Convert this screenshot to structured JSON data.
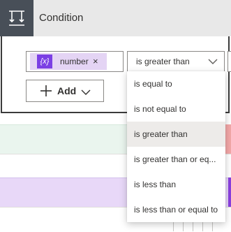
{
  "card": {
    "title": "Condition",
    "icon": "condition-icon"
  },
  "operand": {
    "token_icon": "{x}",
    "token_label": "number",
    "remove_glyph": "×"
  },
  "operator": {
    "selected": "is greater than",
    "chevron": "chevron-down-icon"
  },
  "add_button": {
    "label": "Add"
  },
  "dropdown": {
    "options": [
      {
        "label": "is equal to"
      },
      {
        "label": "is not equal to"
      },
      {
        "label": "is greater than",
        "selected": true
      },
      {
        "label": "is greater than or eq..."
      },
      {
        "label": "is less than"
      },
      {
        "label": "is less than or equal to"
      }
    ]
  },
  "colors": {
    "header_bg": "#e8e8e8",
    "icon_bg": "#484f58",
    "token_bg": "#e4d4f4",
    "token_icon_bg": "#7b3fe4",
    "band_green": "#eaf5ee",
    "band_purple": "#e8d8f8",
    "selected_option_bg": "#edebe9"
  }
}
